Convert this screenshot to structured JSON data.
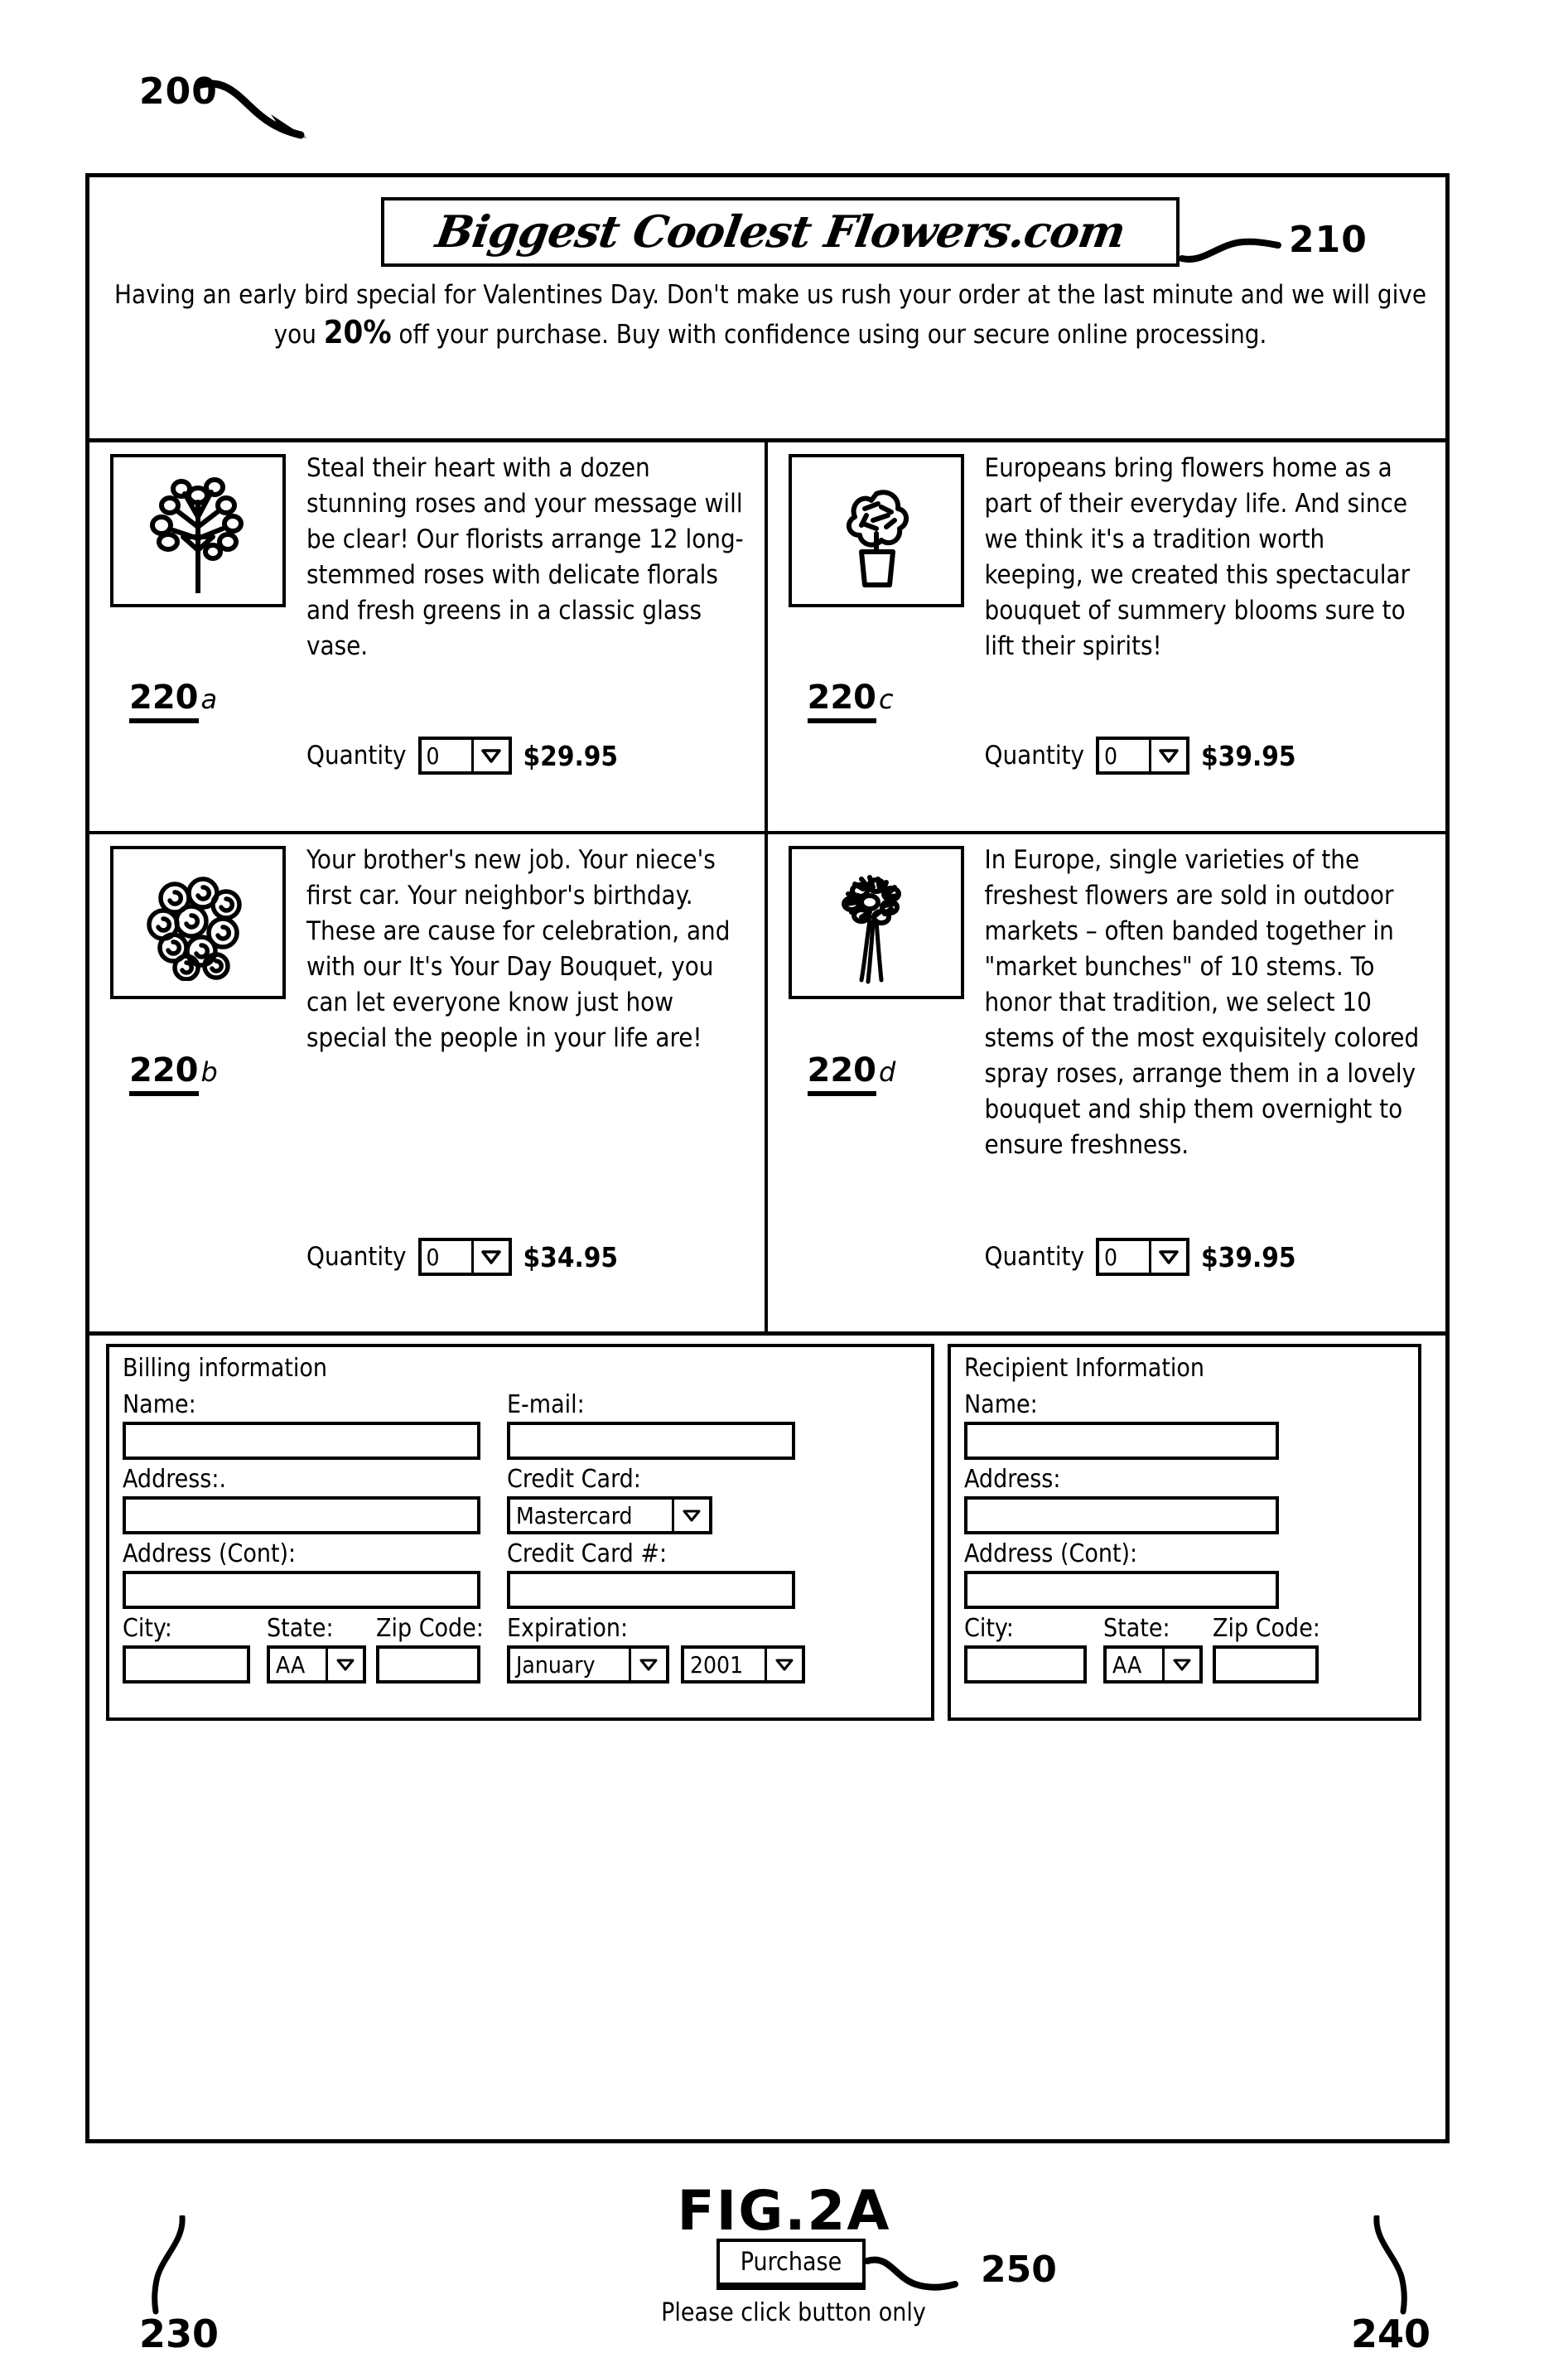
{
  "figure": {
    "caption": "FIG.2A",
    "ref_page": "200",
    "ref_banner": "210",
    "ref_billing": "230",
    "ref_recipient": "240",
    "ref_purchase": "250"
  },
  "header": {
    "logo": "Biggest Coolest Flowers.com",
    "promo_before": "Having an early bird special for Valentines Day. Don't make us rush your order at the last minute and we will give you ",
    "promo_highlight": "20%",
    "promo_after": " off your purchase. Buy with confidence using our secure online processing."
  },
  "products": [
    {
      "ref_num": "220",
      "ref_suffix": "a",
      "image": "rose-bouquet-icon",
      "description": "Steal their heart with a dozen stunning roses and your message will be clear! Our florists arrange 12 long-stemmed roses with delicate florals and fresh greens in a classic glass vase.",
      "quantity_label": "Quantity",
      "quantity_value": "0",
      "price": "$29.95"
    },
    {
      "ref_num": "220",
      "ref_suffix": "c",
      "image": "potted-flower-icon",
      "description": "Europeans bring flowers home as a part of their everyday life. And since we think it's a tradition worth keeping, we created this spectacular bouquet of summery blooms sure to lift their spirits!",
      "quantity_label": "Quantity",
      "quantity_value": "0",
      "price": "$39.95"
    },
    {
      "ref_num": "220",
      "ref_suffix": "b",
      "image": "rose-cluster-icon",
      "description": "Your brother's new job. Your niece's first car. Your neighbor's birthday. These are cause for celebration, and with our It's Your Day Bouquet, you can let everyone know just how special the people in your life are!",
      "quantity_label": "Quantity",
      "quantity_value": "0",
      "price": "$34.95"
    },
    {
      "ref_num": "220",
      "ref_suffix": "d",
      "image": "spray-rose-bunch-icon",
      "description": "In Europe, single varieties of the freshest flowers are sold in outdoor markets – often banded together in \"market bunches\" of 10 stems. To honor that tradition, we select 10 stems of the most exquisitely colored spray roses, arrange them in a lovely bouquet and ship them overnight to ensure freshness.",
      "quantity_label": "Quantity",
      "quantity_value": "0",
      "price": "$39.95"
    }
  ],
  "billing": {
    "title": "Billing information",
    "name_label": "Name:",
    "name_value": "",
    "address_label": "Address:.",
    "address_value": "",
    "address_cont_label": "Address (Cont):",
    "address_cont_value": "",
    "city_label": "City:",
    "city_value": "",
    "state_label": "State:",
    "state_value": "AA",
    "zip_label": "Zip Code:",
    "zip_value": "",
    "email_label": "E-mail:",
    "email_value": "",
    "credit_card_label": "Credit Card:",
    "credit_card_value": "Mastercard",
    "credit_card_num_label": "Credit Card #:",
    "credit_card_num_value": "",
    "expiration_label": "Expiration:",
    "expiration_month": "January",
    "expiration_year": "2001"
  },
  "recipient": {
    "title": "Recipient Information",
    "name_label": "Name:",
    "name_value": "",
    "address_label": "Address:",
    "address_value": "",
    "address_cont_label": "Address (Cont):",
    "address_cont_value": "",
    "city_label": "City:",
    "city_value": "",
    "state_label": "State:",
    "state_value": "AA",
    "zip_label": "Zip Code:",
    "zip_value": ""
  },
  "purchase": {
    "button_label": "Purchase",
    "note": "Please click button only"
  }
}
